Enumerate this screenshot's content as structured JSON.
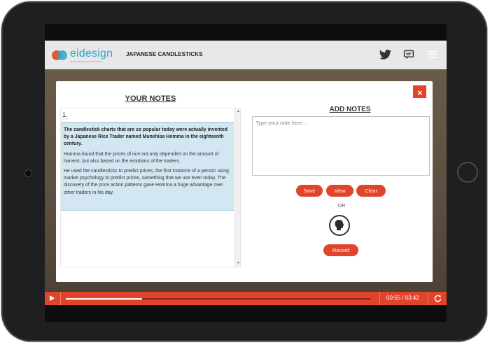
{
  "header": {
    "logo_text": "eidesign",
    "logo_tagline": "ENGAGING ELEARNING",
    "course_title": "JAPANESE CANDLESTICKS",
    "icons": [
      "twitter-icon",
      "chat-icon",
      "menu-icon"
    ]
  },
  "modal": {
    "close_label": "×",
    "your_notes": {
      "heading": "YOUR NOTES",
      "note_number": "1.",
      "paragraphs": [
        "The candlestick charts that are so popular today were actually invented by a Japanese Rice Trader named Munehisa Homma in the eighteenth century.",
        "Homma found that the prices of rice not only depended on the amount of harvest, but also based on the emotions of the traders.",
        "He used the candlesticks to predict prices, the first instance of a person using market psychology to predict prices, something that we use even today. The discovery of the price action patterns gave Homma a huge advantage over other traders in his day."
      ]
    },
    "add_notes": {
      "heading": "ADD NOTES",
      "placeholder": "Type your note here...",
      "value": "",
      "save_label": "Save",
      "view_label": "View",
      "clear_label": "Clear",
      "or_label": "OR",
      "record_label": "Record",
      "mic_icon": "speaking-head-icon"
    }
  },
  "player": {
    "time": "00:55 / 03:42",
    "progress": 0.25,
    "play_icon": "play-icon",
    "replay_icon": "replay-icon"
  },
  "colors": {
    "accent": "#e0442b",
    "note_highlight": "#d3e7f3",
    "brand_blue": "#2aa7c9",
    "brand_orange": "#e05a2f"
  }
}
